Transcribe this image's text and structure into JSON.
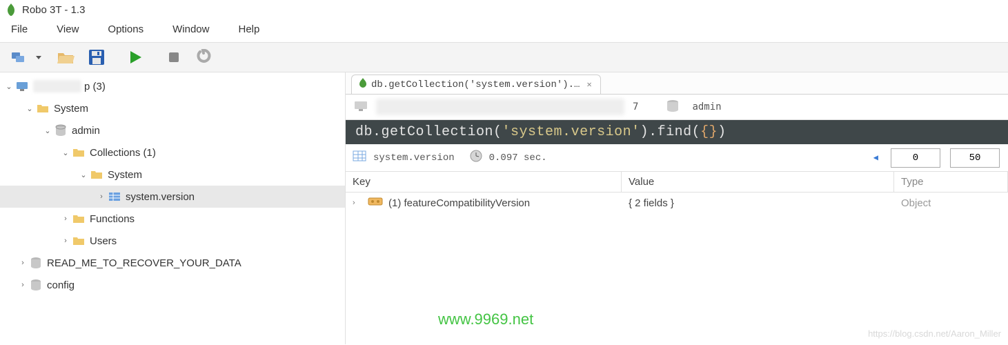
{
  "window": {
    "title": "Robo 3T - 1.3"
  },
  "menu": {
    "items": [
      "File",
      "View",
      "Options",
      "Window",
      "Help"
    ]
  },
  "tree": {
    "connection_suffix": "p (3)",
    "nodes": [
      {
        "label": "System",
        "depth": 1,
        "expanded": true,
        "icon": "folder"
      },
      {
        "label": "admin",
        "depth": 2,
        "expanded": true,
        "icon": "db"
      },
      {
        "label": "Collections (1)",
        "depth": 3,
        "expanded": true,
        "icon": "folder"
      },
      {
        "label": "System",
        "depth": 4,
        "expanded": true,
        "icon": "folder"
      },
      {
        "label": "system.version",
        "depth": 5,
        "expanded": false,
        "icon": "collection",
        "selected": true,
        "leaf_toggle": ">"
      },
      {
        "label": "Functions",
        "depth": 3,
        "expanded": false,
        "icon": "folder",
        "leaf_toggle": ">"
      },
      {
        "label": "Users",
        "depth": 3,
        "expanded": false,
        "icon": "folder",
        "leaf_toggle": ">"
      },
      {
        "label": "READ_ME_TO_RECOVER_YOUR_DATA",
        "depth": 1,
        "expanded": false,
        "icon": "db",
        "leaf_toggle": ">"
      },
      {
        "label": "config",
        "depth": 1,
        "expanded": false,
        "icon": "db",
        "leaf_toggle": ">"
      }
    ]
  },
  "tab": {
    "label": "db.getCollection('system.version').…"
  },
  "context": {
    "visible_digit": "7",
    "db": "admin"
  },
  "query": {
    "prefix": "db.getCollection(",
    "arg": "'system.version'",
    "mid": ").find(",
    "braces": "{}",
    "suffix": ")"
  },
  "info": {
    "collection": "system.version",
    "time": "0.097 sec.",
    "page_start": "0",
    "page_size": "50"
  },
  "result": {
    "headers": {
      "key": "Key",
      "value": "Value",
      "type": "Type"
    },
    "rows": [
      {
        "key": "(1) featureCompatibilityVersion",
        "value": "{ 2 fields }",
        "type": "Object"
      }
    ]
  },
  "watermark": {
    "green": "www.9969.net",
    "grey": "https://blog.csdn.net/Aaron_Miller"
  }
}
